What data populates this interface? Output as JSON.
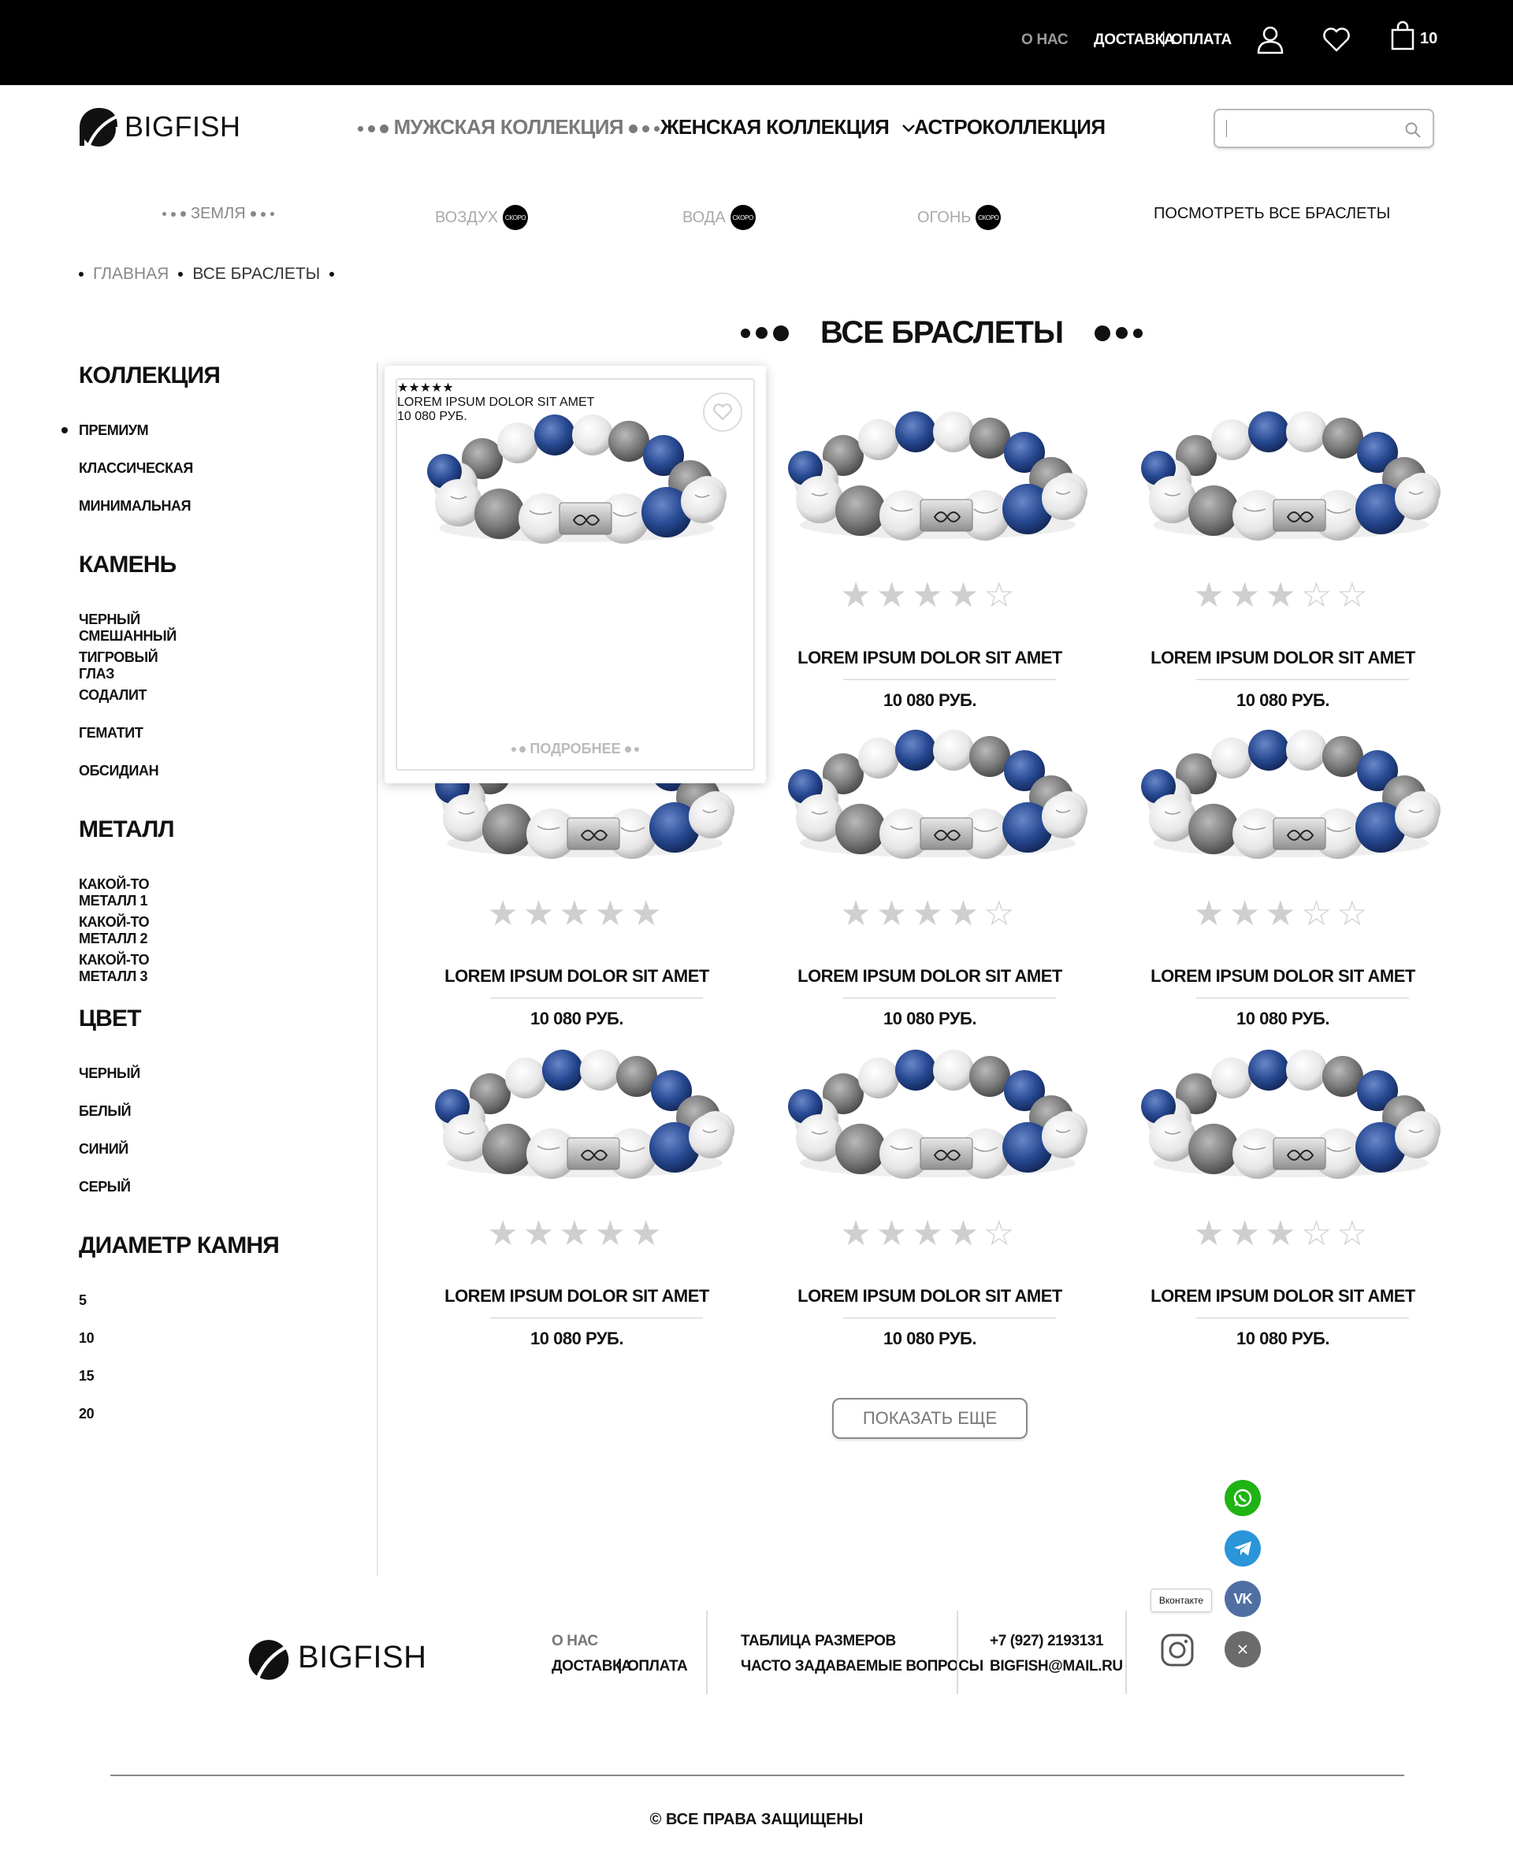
{
  "topbar": {
    "about": "О НАС",
    "delivery": "ДОСТАВКА",
    "payment": "ОПЛАТА",
    "cart_count": "10"
  },
  "header": {
    "logo_text": "BIGFISH",
    "nav": [
      "МУЖСКАЯ КОЛЛЕКЦИЯ",
      "ЖЕНСКАЯ КОЛЛЕКЦИЯ",
      "АСТРОКОЛЛЕКЦИЯ"
    ],
    "search_placeholder": ""
  },
  "subnav": {
    "items": [
      "ЗЕМЛЯ",
      "ВОЗДУХ",
      "ВОДА",
      "ОГОНЬ"
    ],
    "soon_label": "СКОРО",
    "view_all": "ПОСМОТРЕТЬ ВСЕ БРАСЛЕТЫ"
  },
  "breadcrumbs": [
    "ГЛАВНАЯ",
    "ВСЕ БРАСЛЕТЫ"
  ],
  "page_title": "ВСЕ БРАСЛЕТЫ",
  "filters": [
    {
      "title": "КОЛЛЕКЦИЯ",
      "items": [
        "ПРЕМИУМ",
        "КЛАССИЧЕСКАЯ",
        "МИНИМАЛЬНАЯ"
      ]
    },
    {
      "title": "КАМЕНЬ",
      "items": [
        "ЧЕРНЫЙ СМЕШАННЫЙ",
        "ТИГРОВЫЙ ГЛАЗ",
        "СОДАЛИТ",
        "ГЕМАТИТ",
        "ОБСИДИАН"
      ]
    },
    {
      "title": "МЕТАЛЛ",
      "items": [
        "КАКОЙ-ТО МЕТАЛЛ 1",
        "КАКОЙ-ТО МЕТАЛЛ 2",
        "КАКОЙ-ТО МЕТАЛЛ 3"
      ]
    },
    {
      "title": "ЦВЕТ",
      "items": [
        "ЧЕРНЫЙ",
        "БЕЛЫЙ",
        "СИНИЙ",
        "СЕРЫЙ"
      ]
    },
    {
      "title": "ДИАМЕТР КАМНЯ",
      "items": [
        "5",
        "10",
        "15",
        "20"
      ]
    }
  ],
  "products": [
    {
      "name": "LOREM IPSUM DOLOR SIT AMET",
      "price": "10 080 РУБ.",
      "rating": 5
    },
    {
      "name": "LOREM IPSUM DOLOR SIT AMET",
      "price": "10 080 РУБ.",
      "rating": 4
    },
    {
      "name": "LOREM IPSUM DOLOR SIT AMET",
      "price": "10 080 РУБ.",
      "rating": 3
    },
    {
      "name": "LOREM IPSUM DOLOR SIT AMET",
      "price": "10 080 РУБ.",
      "rating": 5
    },
    {
      "name": "LOREM IPSUM DOLOR SIT AMET",
      "price": "10 080 РУБ.",
      "rating": 4
    },
    {
      "name": "LOREM IPSUM DOLOR SIT AMET",
      "price": "10 080 РУБ.",
      "rating": 3
    },
    {
      "name": "LOREM IPSUM DOLOR SIT AMET",
      "price": "10 080 РУБ.",
      "rating": 5
    },
    {
      "name": "LOREM IPSUM DOLOR SIT AMET",
      "price": "10 080 РУБ.",
      "rating": 4
    },
    {
      "name": "LOREM IPSUM DOLOR SIT AMET",
      "price": "10 080 РУБ.",
      "rating": 3
    }
  ],
  "featured_more": "ПОДРОБНЕЕ",
  "show_more": "ПОКАЗАТЬ ЕЩЕ",
  "social": {
    "vk_tooltip": "Вконтакте",
    "colors": {
      "whatsapp": "#1fb314",
      "telegram": "#2a95d8",
      "vk": "#4f6fa3",
      "close": "#6b6b6b"
    }
  },
  "footer": {
    "logo_text": "BIGFISH",
    "about": "О НАС",
    "delivery": "ДОСТАВКА",
    "payment": "ОПЛАТА",
    "sizes": "ТАБЛИЦА РАЗМЕРОВ",
    "faq": "ЧАСТО ЗАДАВАЕМЫЕ ВОПРОСЫ",
    "phone": "+7 (927) 2193131",
    "email": "BIGFISH@MAIL.RU",
    "copyright": "© ВСЕ ПРАВА ЗАЩИЩЕНЫ"
  }
}
